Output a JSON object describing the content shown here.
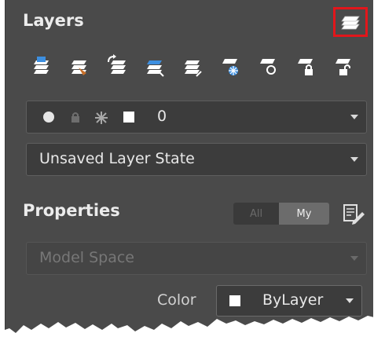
{
  "layers": {
    "title": "Layers",
    "toolbar": [
      "layer-properties-icon",
      "match-layer-icon",
      "previous-layer-icon",
      "layer-isolate-icon",
      "layer-unisolate-icon",
      "layer-freeze-icon",
      "layer-off-icon",
      "layer-lock-icon",
      "layer-unlock-icon"
    ],
    "current_layer": {
      "name": "0",
      "icons": [
        "on-bulb-icon",
        "lock-icon",
        "freeze-sun-icon",
        "color-swatch-icon"
      ]
    },
    "layer_state": "Unsaved Layer State"
  },
  "properties": {
    "title": "Properties",
    "toggle": {
      "all": "All",
      "my": "My",
      "selected": "My"
    },
    "space": "Model Space",
    "color_label": "Color",
    "color_value": "ByLayer",
    "color_swatch": "#ffffff"
  },
  "colors": {
    "panel": "#4a4a4a",
    "highlight_border": "#e2161b",
    "accent_blue": "#3d8fe0"
  }
}
